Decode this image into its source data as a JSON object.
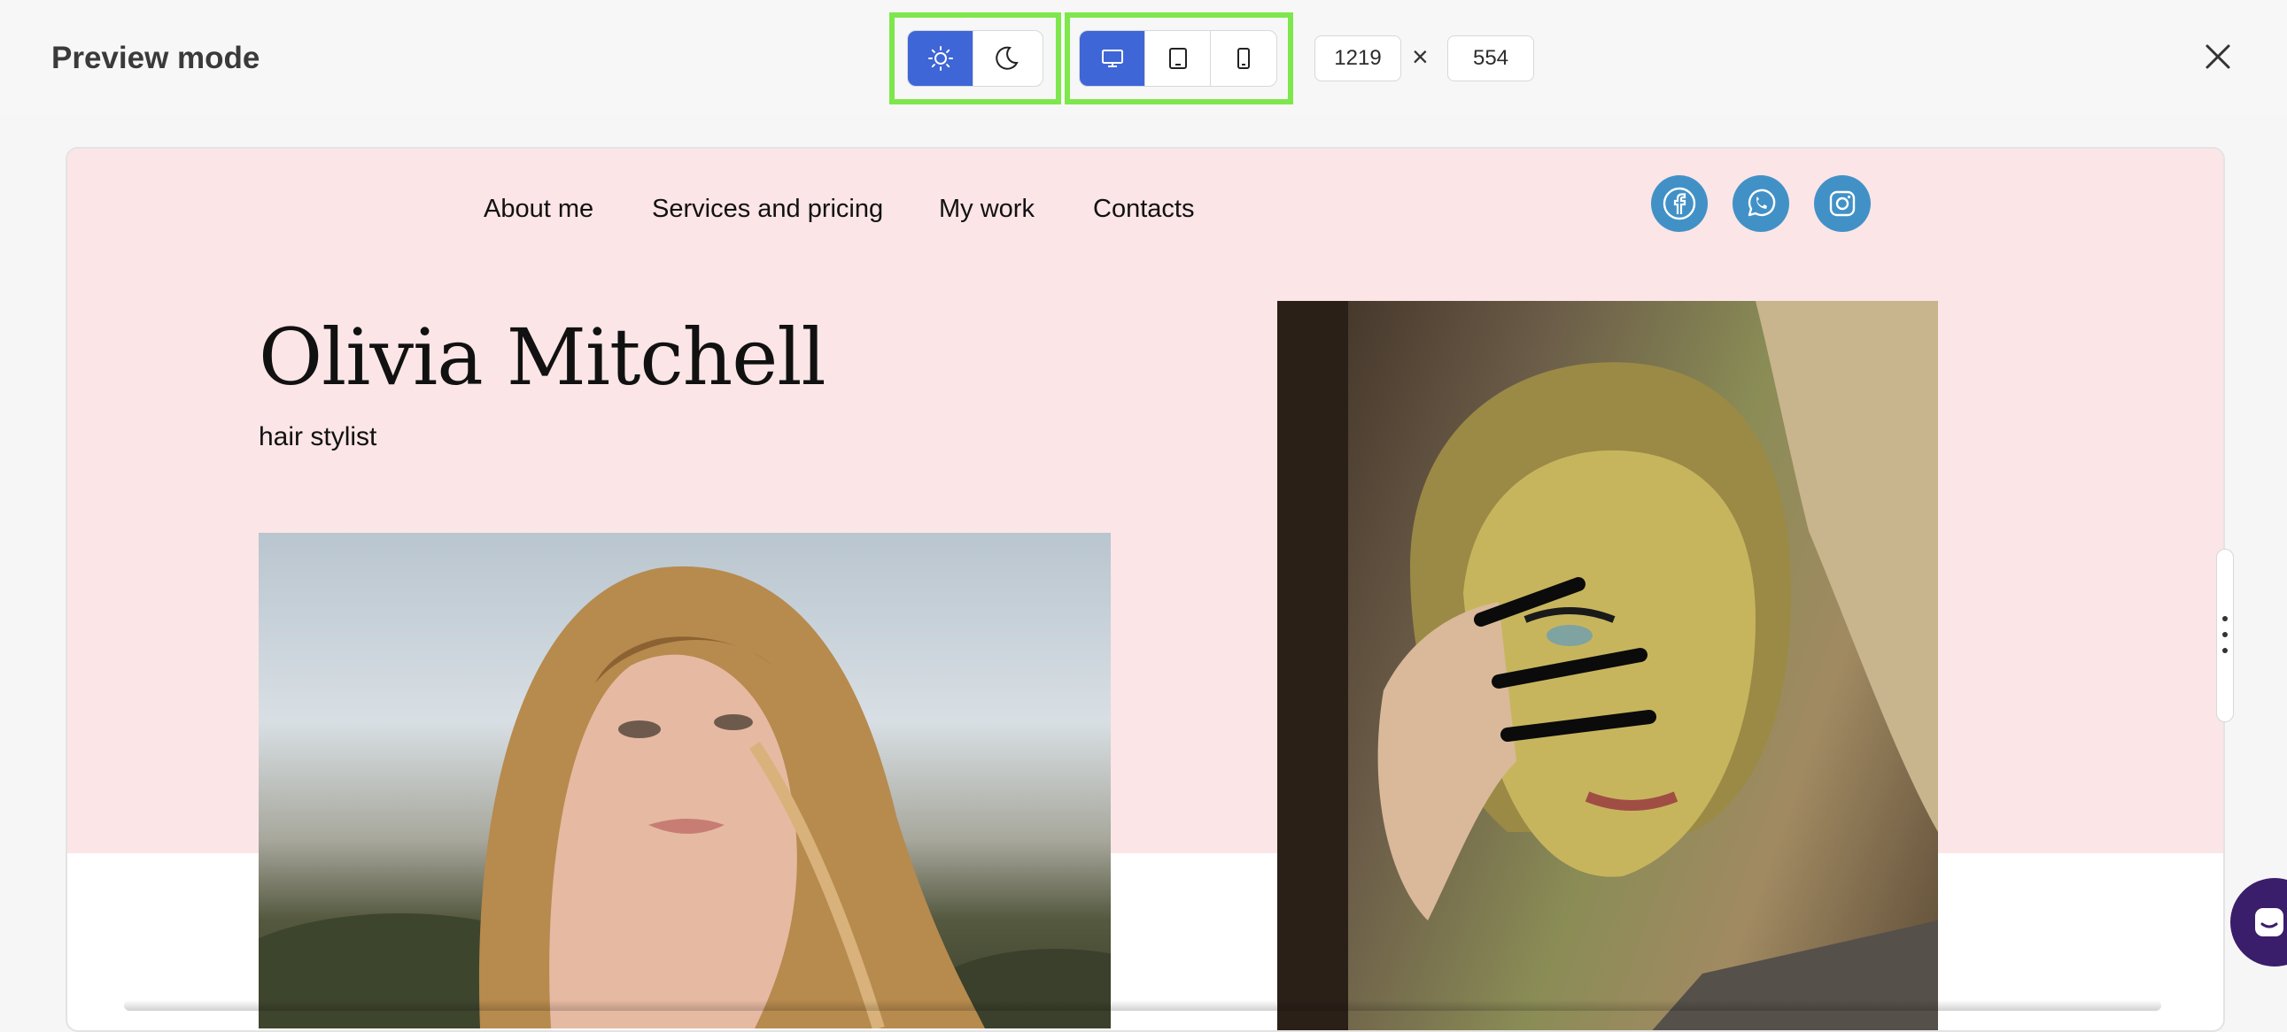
{
  "header": {
    "title": "Preview mode",
    "width_value": "1219",
    "height_value": "554",
    "times_symbol": "×"
  },
  "theme_toggle": [
    {
      "icon": "sun-icon",
      "active": true
    },
    {
      "icon": "moon-icon",
      "active": false
    }
  ],
  "device_toggle": [
    {
      "icon": "desktop-icon",
      "active": true
    },
    {
      "icon": "tablet-icon",
      "active": false
    },
    {
      "icon": "phone-icon",
      "active": false
    }
  ],
  "site": {
    "nav": [
      "About me",
      "Services and pricing",
      "My work",
      "Contacts"
    ],
    "social": [
      "facebook-icon",
      "whatsapp-icon",
      "instagram-icon"
    ],
    "name": "Olivia Mitchell",
    "subtitle": "hair stylist",
    "colors": {
      "hero_bg": "#fbe5e6",
      "social": "#4191c7"
    }
  },
  "colors": {
    "accent": "#3f66d6",
    "highlight": "#7ee74c",
    "chat": "#3a1d6b"
  }
}
